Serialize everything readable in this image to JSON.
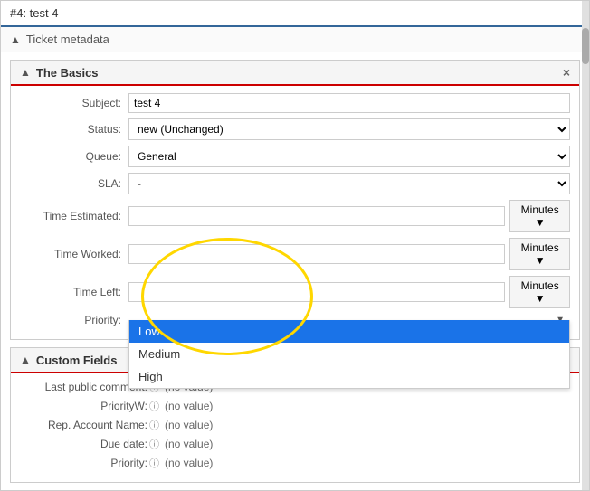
{
  "window": {
    "title": "#4: test 4"
  },
  "ticket_metadata": {
    "label": "Ticket metadata",
    "expand_icon": "▲"
  },
  "the_basics": {
    "label": "The Basics",
    "expand_icon": "▲",
    "close_label": "×",
    "fields": {
      "subject_label": "Subject:",
      "subject_value": "test 4",
      "status_label": "Status:",
      "status_value": "new (Unchanged)",
      "queue_label": "Queue:",
      "queue_value": "General",
      "sla_label": "SLA:",
      "sla_value": "-",
      "time_estimated_label": "Time Estimated:",
      "time_estimated_value": "",
      "time_estimated_minutes": "Minutes ▼",
      "time_worked_label": "Time Worked:",
      "time_worked_value": "",
      "time_worked_minutes": "Minutes ▼",
      "time_left_label": "Time Left:",
      "time_left_value": "",
      "time_left_minutes": "Minutes ▼",
      "priority_label": "Priority:",
      "priority_value": "Low"
    },
    "priority_options": [
      {
        "label": "Low",
        "selected": true
      },
      {
        "label": "Medium",
        "selected": false
      },
      {
        "label": "High",
        "selected": false
      }
    ]
  },
  "custom_fields": {
    "label": "Custom Fields",
    "expand_icon": "▲",
    "edit_icon": "✎",
    "rows": [
      {
        "label": "Last public comment:",
        "value": "(no value)"
      },
      {
        "label": "PriorityW:",
        "value": "(no value)"
      },
      {
        "label": "Rep. Account Name:",
        "value": "(no value)"
      },
      {
        "label": "Due date:",
        "value": "(no value)"
      },
      {
        "label": "Priority:",
        "value": "(no value)"
      }
    ]
  }
}
